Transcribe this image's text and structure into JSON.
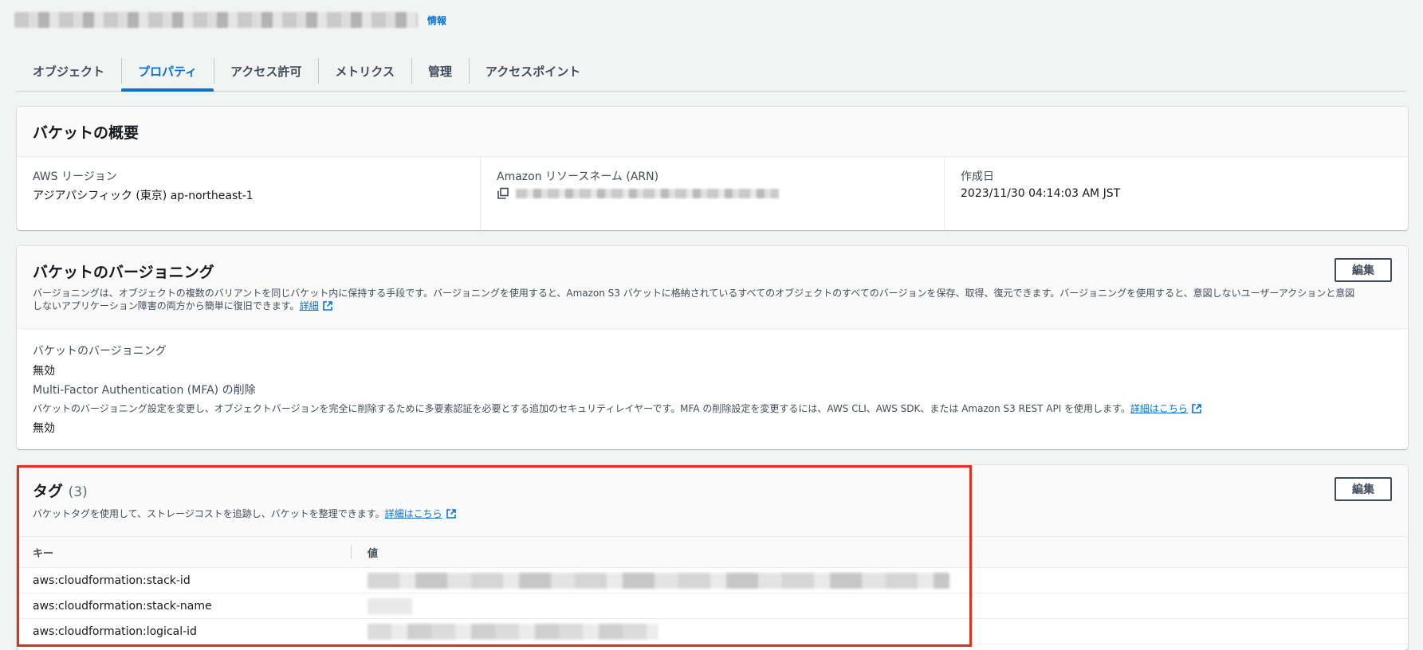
{
  "header": {
    "info_label": "情報"
  },
  "tabs": [
    {
      "label": "オブジェクト",
      "active": false
    },
    {
      "label": "プロパティ",
      "active": true
    },
    {
      "label": "アクセス許可",
      "active": false
    },
    {
      "label": "メトリクス",
      "active": false
    },
    {
      "label": "管理",
      "active": false
    },
    {
      "label": "アクセスポイント",
      "active": false
    }
  ],
  "overview": {
    "title": "バケットの概要",
    "region_label": "AWS リージョン",
    "region_value": "アジアパシフィック (東京) ap-northeast-1",
    "arn_label": "Amazon リソースネーム (ARN)",
    "created_label": "作成日",
    "created_value": "2023/11/30 04:14:03 AM JST"
  },
  "versioning": {
    "title": "バケットのバージョニング",
    "description": "バージョニングは、オブジェクトの複数のバリアントを同じバケット内に保持する手段です。バージョニングを使用すると、Amazon S3 バケットに格納されているすべてのオブジェクトのすべてのバージョンを保存、取得、復元できます。バージョニングを使用すると、意図しないユーザーアクションと意図しないアプリケーション障害の両方から簡単に復旧できます。",
    "learn_more": "詳細",
    "edit_label": "編集",
    "status_label": "バケットのバージョニング",
    "status_value": "無効",
    "mfa_label": "Multi-Factor Authentication (MFA) の削除",
    "mfa_description": "バケットのバージョニング設定を変更し、オブジェクトバージョンを完全に削除するために多要素認証を必要とする追加のセキュリティレイヤーです。MFA の削除設定を変更するには、AWS CLI、AWS SDK、または Amazon S3 REST API を使用します。",
    "mfa_learn_more": "詳細はこちら",
    "mfa_value": "無効"
  },
  "tags": {
    "title": "タグ",
    "count": "(3)",
    "description": "バケットタグを使用して、ストレージコストを追跡し、バケットを整理できます。",
    "learn_more": "詳細はこちら",
    "edit_label": "編集",
    "columns": {
      "key": "キー",
      "value": "値"
    },
    "rows": [
      {
        "key": "aws:cloudformation:stack-id"
      },
      {
        "key": "aws:cloudformation:stack-name"
      },
      {
        "key": "aws:cloudformation:logical-id"
      }
    ]
  },
  "colors": {
    "accent": "#0972d3",
    "highlight": "#e0301e",
    "text": "#16191f"
  }
}
